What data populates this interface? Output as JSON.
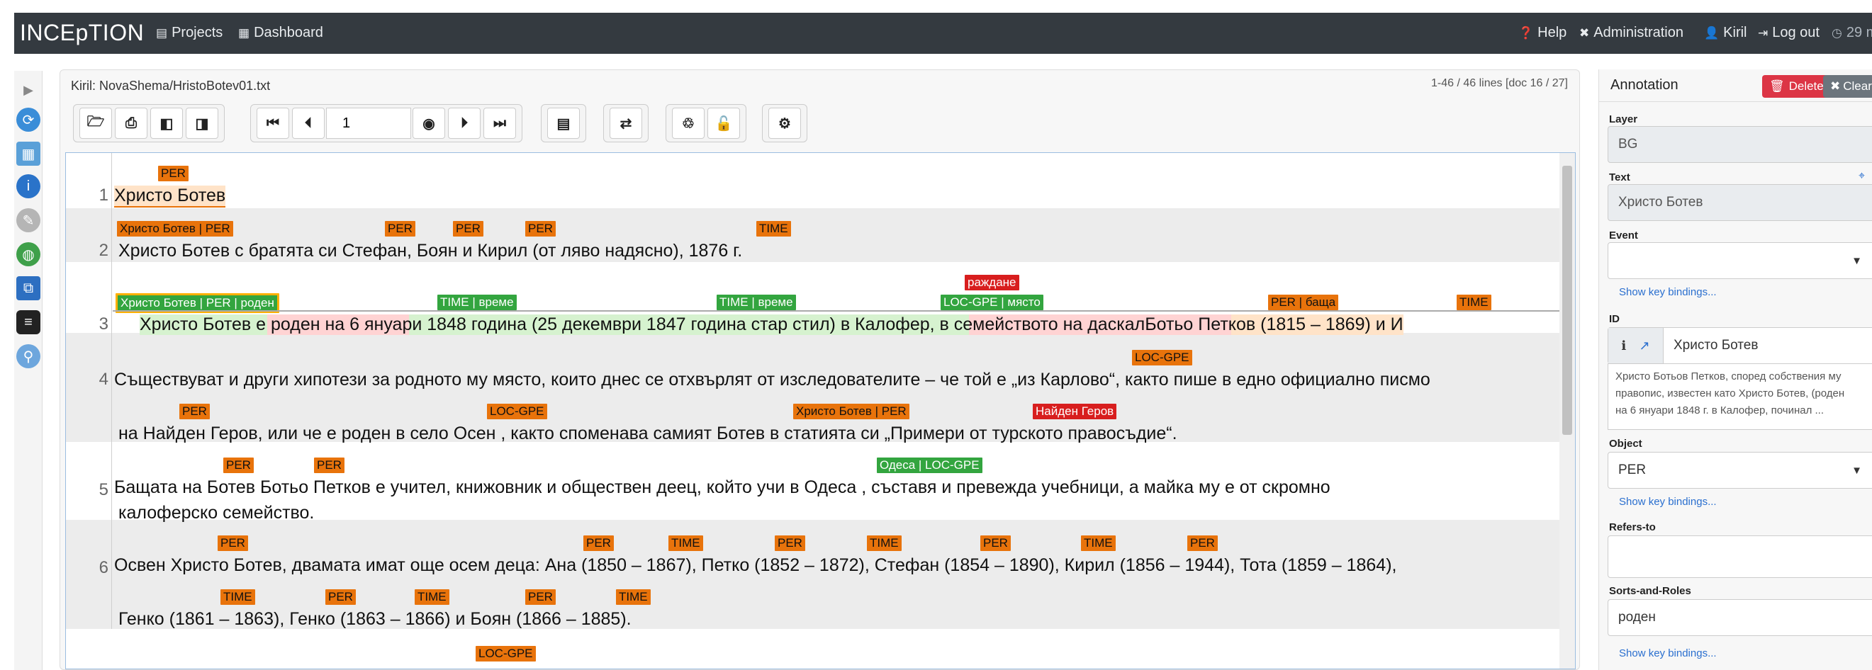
{
  "navbar": {
    "brand": "INCEpTION",
    "projects": "Projects",
    "dashboard": "Dashboard",
    "help": "Help",
    "administration": "Administration",
    "user": "Kiril",
    "logout": "Log out",
    "timer": "29 m"
  },
  "document": {
    "title": "Kiril: NovaShema/HristoBotev01.txt",
    "info": "1-46 / 46 lines [doc 16 / 27]",
    "page_value": "1"
  },
  "lines": [
    {
      "num": "1"
    },
    {
      "num": "2"
    },
    {
      "num": "3"
    },
    {
      "num": "4"
    },
    {
      "num": "5"
    },
    {
      "num": "6"
    }
  ],
  "text": {
    "l1": "Христо Ботев",
    "l2": "Христо Ботев  с братята си Стефан, Боян и Кирил (от ляво надясно), 1876 г.",
    "l3": "Христо Ботев е роден на 6 януари 1848 година (25 декември 1847 година стар стил) в Калофер, в семейството на даскалБотьо Петков (1815 – 1869) и И",
    "l4a": "Съществуват и други хипотези за родното му място, които днес се отхвърлят от изследователите – че той е „из Карлово“, както пише в едно официално писмо",
    "l4b": "на Найден Геров, или че е роден в село  Осен   , както споменава самият       Ботев         в статията          си        „Примери от турското правосъдие“.",
    "l5a": "Бащата на Ботев Ботьо Петков е учител, книжовник и обществен деец, който учи в        Одеса        , съставя и превежда учебници, а майка му е от скромно",
    "l5b": "калоферско семейство.",
    "l6a": "Освен Христо Ботев, двамата имат още осем деца:  Ана  (1850 – 1867), Петко (1852 – 1872), Стефан (1854 – 1890), Кирил (1856 – 1944), Тота (1859 – 1864),",
    "l6b": "Генко (1861 – 1863), Генко (1863 – 1866) и Боян (1866 – 1885)."
  },
  "labels": {
    "per": "PER",
    "time": "TIME",
    "loc_gpe": "LOC-GPE",
    "botev_per": "Христо Ботев | PER",
    "botev_per_roden": "Христо Ботев | PER | роден",
    "time_vreme": "TIME | време",
    "loc_gpe_mqsto": "LOC-GPE | място",
    "razhdane": "раждане",
    "per_bashta": "PER | баща",
    "botev_only_per": "Христо Ботев | PER",
    "naiden_gerov": "Найден Геров",
    "odesa_loc": "Одеса | LOC-GPE"
  },
  "annotation": {
    "title": "Annotation",
    "delete": "Delete",
    "clear": "Clear",
    "layer_label": "Layer",
    "layer_value": "BG",
    "text_label": "Text",
    "text_value": "Христо Ботев",
    "event_label": "Event",
    "event_value": "",
    "keybindings": "Show key bindings...",
    "id_label": "ID",
    "id_value": "Христо Ботев",
    "id_desc": "Христо Ботьов Петков, според собствения му правопис, известен като Христо Ботев, (роден на 6 януари 1848 г. в Калофер, починал ...",
    "object_label": "Object",
    "object_value": "PER",
    "refers_label": "Refers-to",
    "refers_value": "",
    "sorts_label": "Sorts-and-Roles",
    "sorts_value": "роден"
  },
  "colors": {
    "per": "#e8730b",
    "time": "#e8730b",
    "loc": "#33a53f",
    "event": "#d81e1e",
    "navbar": "#343a40"
  }
}
